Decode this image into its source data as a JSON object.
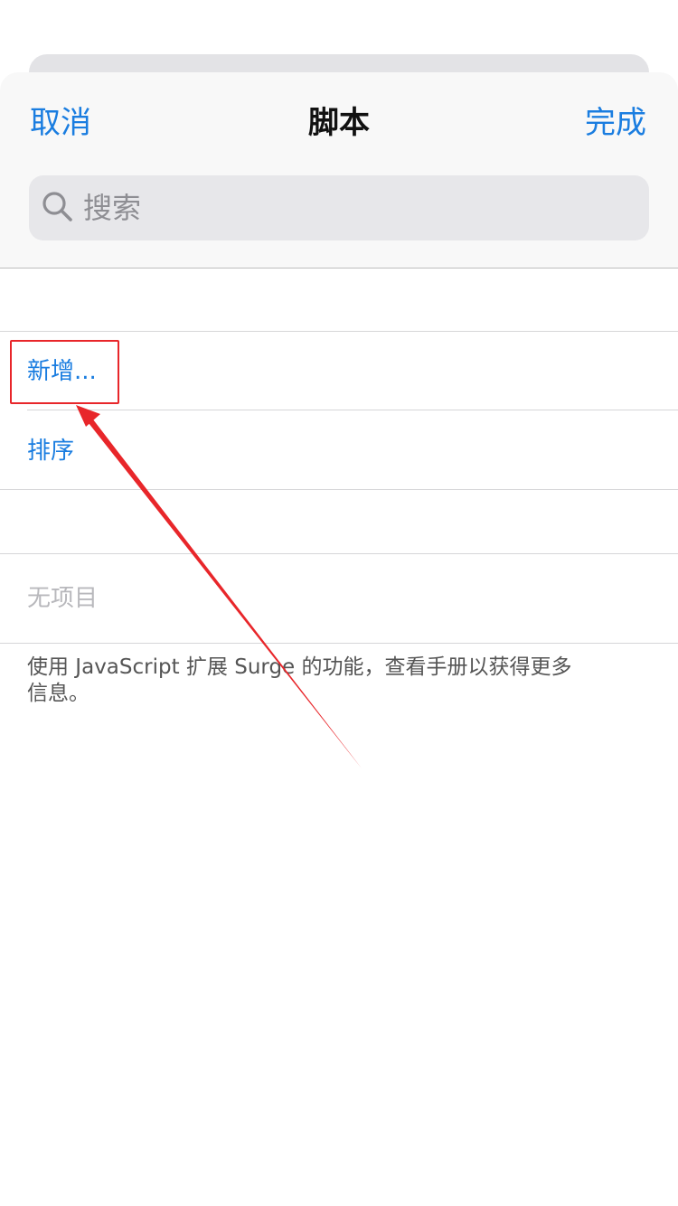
{
  "nav": {
    "cancel_label": "取消",
    "title": "脚本",
    "done_label": "完成"
  },
  "search": {
    "placeholder": "搜索"
  },
  "actions": {
    "add_label": "新增...",
    "sort_label": "排序"
  },
  "list": {
    "empty_label": "无项目"
  },
  "footer": {
    "text": "使用 JavaScript 扩展 Surge 的功能，查看手册以获得更多信息。"
  },
  "colors": {
    "accent": "#1a7de0",
    "annotation": "#e8262a"
  },
  "icons": {
    "search": "search-icon"
  }
}
